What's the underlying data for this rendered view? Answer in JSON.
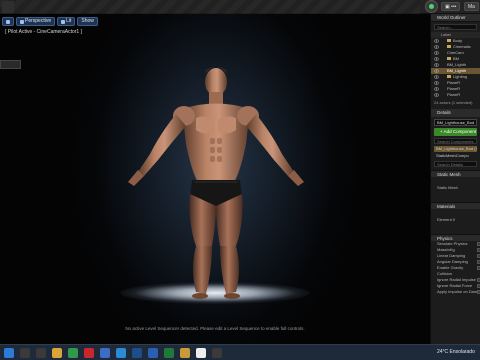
{
  "topbar": {
    "btn1": "▣ •••",
    "btn2": "Ma"
  },
  "viewport": {
    "toolbar": [
      {
        "label": "Perspective",
        "icon": "perspective-icon"
      },
      {
        "label": "Lit",
        "icon": "lit-icon"
      },
      {
        "label": "Show",
        "icon": "show-icon"
      }
    ],
    "pilot": "[ Pilot Active - CineCameraActor1 ]",
    "side_button": "",
    "message": "No active Level Sequencer detected. Please edit a Level Sequence to enable full controls."
  },
  "outliner": {
    "tab": "World Outliner",
    "search_placeholder": "Search...",
    "label_header": "Label",
    "rows": [
      {
        "label": "Body",
        "folder": true,
        "selected": false
      },
      {
        "label": "Cinematic",
        "folder": true,
        "selected": false
      },
      {
        "label": "CineCam",
        "folder": false,
        "selected": false
      },
      {
        "label": "BM",
        "folder": true,
        "selected": false
      },
      {
        "label": "BM_Lighth",
        "folder": false,
        "selected": false
      },
      {
        "label": "BM_Lighth",
        "folder": false,
        "selected": true
      },
      {
        "label": "Lighting",
        "folder": true,
        "selected": false
      },
      {
        "label": "PlaneR",
        "folder": false,
        "selected": false
      },
      {
        "label": "PlaneR",
        "folder": false,
        "selected": false
      },
      {
        "label": "PlaneR",
        "folder": false,
        "selected": false
      }
    ],
    "count": "24 actors (1 selected)"
  },
  "details": {
    "tab": "Details",
    "name_value": "BM_Lighthouse_Bod",
    "add_component": "+ Add Component",
    "search_placeholder": "Search Components",
    "components": [
      {
        "label": "BM_Lighthouse_Bod (I",
        "selected": true
      },
      {
        "label": "StaticMeshCompo",
        "selected": false
      }
    ],
    "search_details": "Search Details",
    "sections": {
      "static_mesh": "Static Mesh",
      "static_mesh_prop": "Static Mesh",
      "materials": "Materials",
      "element0": "Element 0",
      "physics": "Physics",
      "collision": "Collision"
    },
    "physics_props": [
      "Simulate Physics",
      "MassInKg",
      "Linear Damping",
      "Angular Damping",
      "Enable Gravity"
    ],
    "collision_props": [
      "Ignore Radial Impulse",
      "Ignore Radial Force",
      "Apply Impulse on Dam"
    ]
  },
  "taskbar": {
    "temperature": "24°C  Ensolarado",
    "icons": [
      "windows-icon",
      "search-icon",
      "taskview-icon",
      "explorer-icon",
      "chrome-icon",
      "opera-icon",
      "store-icon",
      "edge-icon",
      "photoshop-icon",
      "word-icon",
      "excel-icon",
      "folder-icon",
      "unreal-icon",
      "terminal-icon"
    ]
  },
  "colors": {
    "accent_green": "#3a8a2a",
    "selection": "#6b5632",
    "viewport_blue": "#263548"
  }
}
